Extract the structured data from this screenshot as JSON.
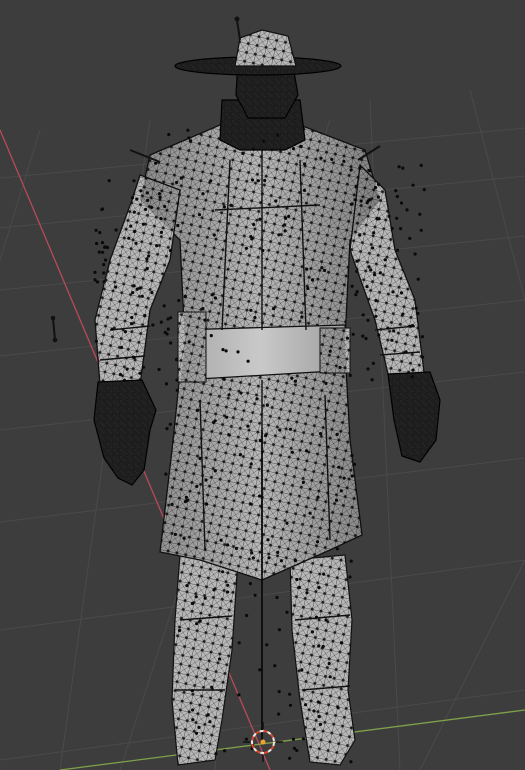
{
  "viewport": {
    "background": "#3d3d3d",
    "grid_color": "#4a4a4a",
    "x_axis_color": "#c05060",
    "y_axis_color": "#7fa04a"
  },
  "model": {
    "mesh_fill": "#b4b4b4",
    "mesh_shadow": "#8f8f8f",
    "wire_color": "#111111",
    "dark_parts_color": "#1c1c1c"
  },
  "icons": {
    "cursor": "3d-cursor-icon",
    "light": "light-empty-icon"
  },
  "cursor_colors": {
    "ring_a": "#e8e8e8",
    "ring_b": "#d84a2a"
  }
}
